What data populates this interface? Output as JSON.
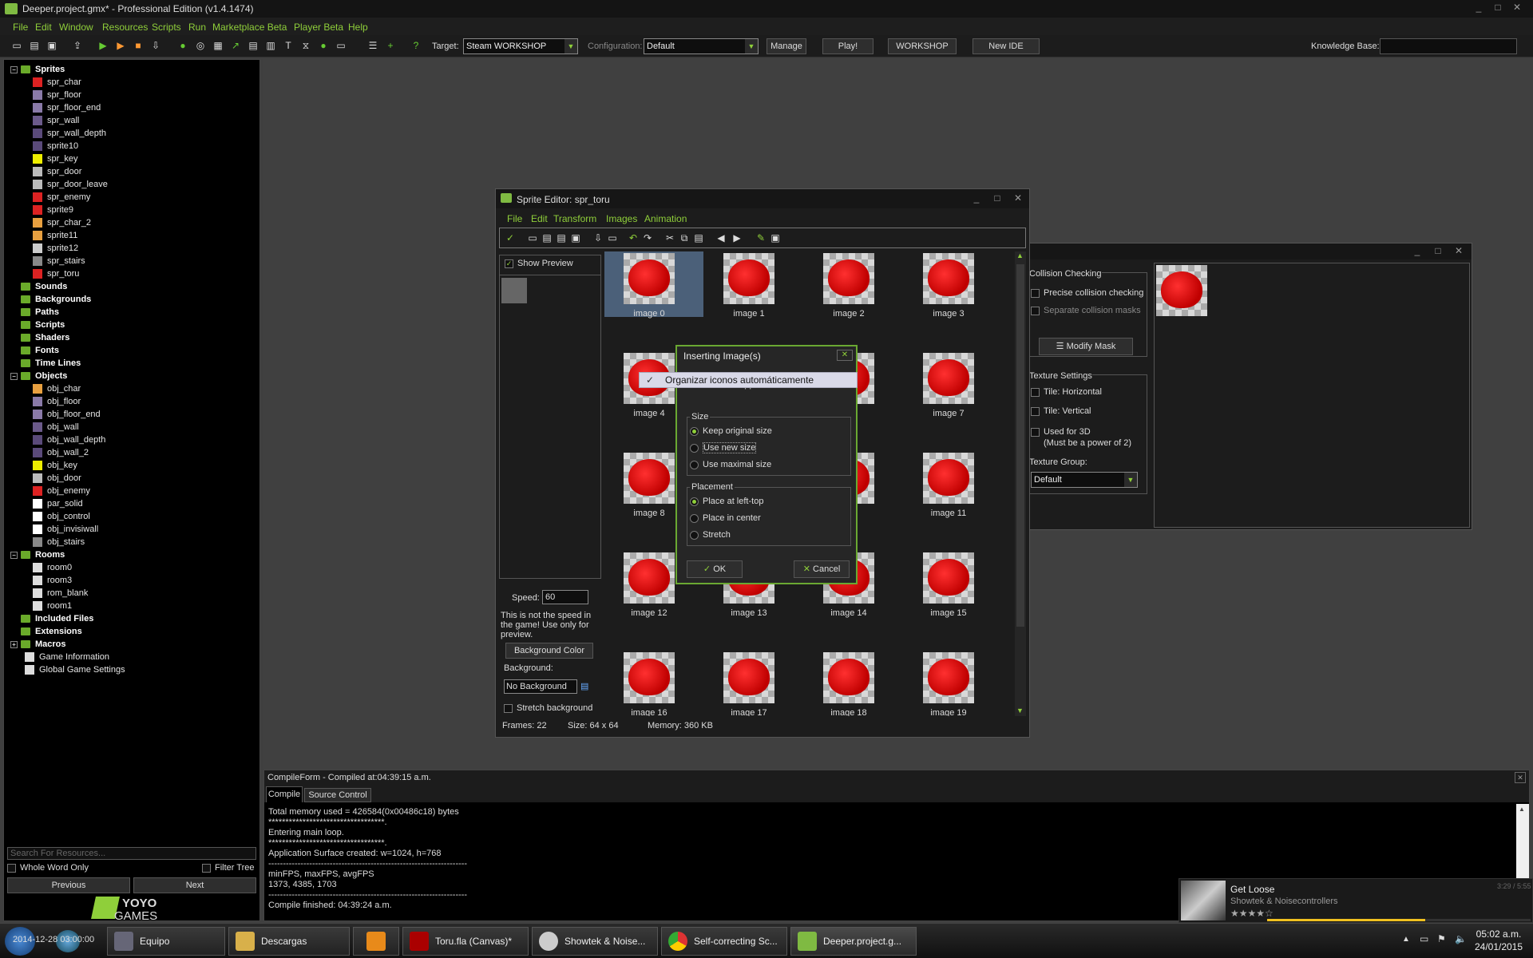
{
  "window": {
    "title": "Deeper.project.gmx* - Professional Edition (v1.4.1474)"
  },
  "menu": [
    "File",
    "Edit",
    "Window",
    "Resources",
    "Scripts",
    "Run",
    "Marketplace Beta",
    "Player Beta",
    "Help"
  ],
  "toolbar": {
    "target_label": "Target:",
    "target_value": "Steam WORKSHOP",
    "config_label": "Configuration:",
    "config_value": "Default",
    "manage": "Manage",
    "play": "Play!",
    "workshop": "WORKSHOP",
    "new_ide": "New IDE",
    "knowledge_label": "Knowledge Base:"
  },
  "tree": {
    "sprites": "Sprites",
    "sprite_items": [
      "spr_char",
      "spr_floor",
      "spr_floor_end",
      "spr_wall",
      "spr_wall_depth",
      "sprite10",
      "spr_key",
      "spr_door",
      "spr_door_leave",
      "spr_enemy",
      "sprite9",
      "spr_char_2",
      "sprite11",
      "sprite12",
      "spr_stairs",
      "spr_toru"
    ],
    "sounds": "Sounds",
    "backgrounds": "Backgrounds",
    "paths": "Paths",
    "scripts": "Scripts",
    "shaders": "Shaders",
    "fonts": "Fonts",
    "timelines": "Time Lines",
    "objects": "Objects",
    "object_items": [
      "obj_char",
      "obj_floor",
      "obj_floor_end",
      "obj_wall",
      "obj_wall_depth",
      "obj_wall_2",
      "obj_key",
      "obj_door",
      "obj_enemy",
      "par_solid",
      "obj_control",
      "obj_invisiwall",
      "obj_stairs"
    ],
    "rooms": "Rooms",
    "room_items": [
      "room0",
      "room3",
      "rom_blank",
      "room1"
    ],
    "included_files": "Included Files",
    "extensions": "Extensions",
    "macros": "Macros",
    "game_info": "Game Information",
    "global_settings": "Global Game Settings"
  },
  "search": {
    "placeholder": "Search For Resources...",
    "whole_word": "Whole Word Only",
    "filter_tree": "Filter Tree",
    "previous": "Previous",
    "next": "Next"
  },
  "logo": {
    "line1": "YOYO",
    "line2": "GAMES"
  },
  "sprite_editor": {
    "title": "Sprite Editor: spr_toru",
    "menu": [
      "File",
      "Edit",
      "Transform",
      "Images",
      "Animation"
    ],
    "show_preview": "Show Preview",
    "speed_label": "Speed:",
    "speed_value": "60",
    "speed_note": "This is not the speed in the game! Use only for preview.",
    "bg_color_button": "Background Color",
    "background_label": "Background:",
    "background_value": "No Background",
    "stretch_background": "Stretch background",
    "frames": "Frames: 22",
    "size": "Size: 64 x 64",
    "memory": "Memory: 360 KB",
    "images": [
      "image 0",
      "image 1",
      "image 2",
      "image 3",
      "image 4",
      "image 7",
      "image 8",
      "image 11",
      "image 12",
      "image 13",
      "image 14",
      "image 15",
      "image 16",
      "image 17",
      "image 18",
      "image 19"
    ],
    "partial_6": "e 6",
    "partial_10": "10"
  },
  "props": {
    "collision_checking": "Collision Checking",
    "precise": "Precise collision checking",
    "separate": "Separate collision masks",
    "modify_mask": "Modify Mask",
    "texture_settings": "Texture Settings",
    "tile_h": "Tile: Horizontal",
    "tile_v": "Tile: Vertical",
    "used_3d": "Used for 3D",
    "power_of_2": "(Must be a power of 2)",
    "texture_group": "Texture Group:",
    "texture_group_value": "Default"
  },
  "dialog": {
    "title": "Inserting Image(s)",
    "context_item": "Organizar iconos automáticamente",
    "question": "What should happen?",
    "size_group": "Size",
    "size_options": [
      "Keep original size",
      "Use new size",
      "Use maximal size"
    ],
    "placement_group": "Placement",
    "placement_options": [
      "Place at left-top",
      "Place in center",
      "Stretch"
    ],
    "ok": "OK",
    "cancel": "Cancel"
  },
  "compile": {
    "title": "CompileForm - Compiled at:04:39:15 a.m.",
    "tabs": [
      "Compile",
      "Source Control"
    ],
    "lines": [
      "Total memory used = 426584(0x00486c18) bytes",
      "**********************************.",
      "Entering main loop.",
      "**********************************.",
      "Application Surface created: w=1024, h=768",
      "--------------------------------------------------------------------",
      "minFPS, maxFPS, avgFPS",
      "1373, 4385, 1703",
      "--------------------------------------------------------------------",
      "Compile finished: 04:39:24 a.m."
    ]
  },
  "notification": {
    "title": "Get Loose",
    "subtitle": "Showtek & Noisecontrollers",
    "time": "3:29 / 5:55"
  },
  "taskbar": {
    "tasks": [
      "Equipo",
      "Descargas",
      "",
      "Toru.fla (Canvas)*",
      "Showtek & Noise...",
      "Self-correcting Sc...",
      "Deeper.project.g..."
    ],
    "clock_time": "05:02 a.m.",
    "clock_date": "24/01/2015",
    "overlay_text": "2014-12-28 03:00:00"
  },
  "colors": {
    "accent": "#8fcf3a",
    "sprite_red": "#e00000"
  }
}
